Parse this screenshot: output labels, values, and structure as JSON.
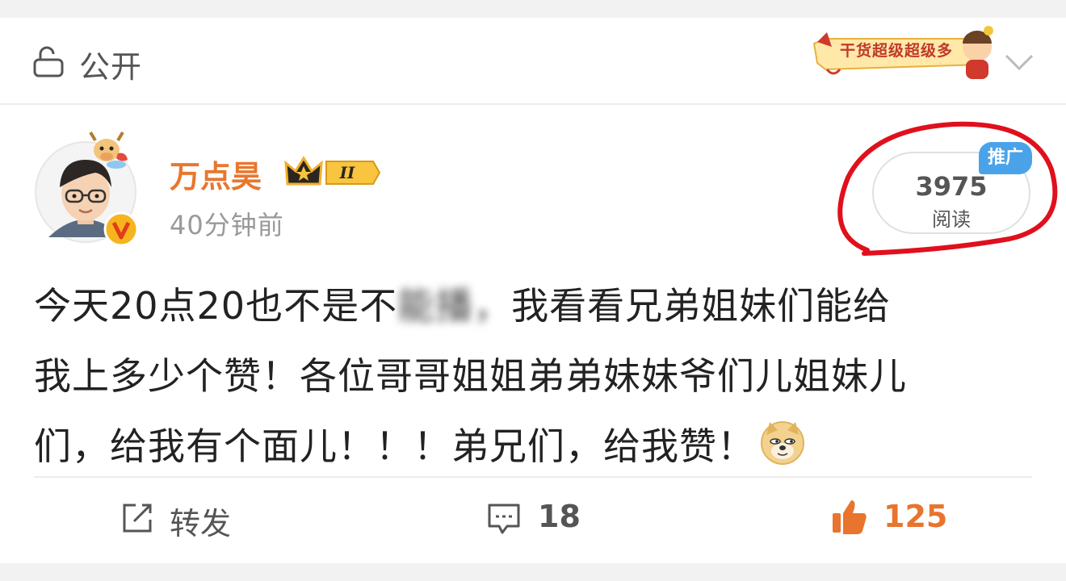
{
  "visibility": {
    "label": "公开"
  },
  "banner": {
    "text": "干货超级超级多"
  },
  "post": {
    "author": "万点昊",
    "vip_level": "II",
    "time": "40分钟前",
    "reads": {
      "count": "3975",
      "label": "阅读",
      "tag": "推广"
    },
    "text_line1_a": "今天20点20也不是不",
    "text_line1_blur": "能播，",
    "text_line1_b": "我看看兄弟姐妹们能给",
    "text_line2": "我上多少个赞！各位哥哥姐姐弟弟妹妹爷们儿姐妹儿",
    "text_line3": "们，给我有个面儿！！！弟兄们，给我赞！"
  },
  "actions": {
    "repost_label": "转发",
    "comment_count": "18",
    "like_count": "125"
  },
  "colors": {
    "author": "#e8772e",
    "like": "#e8742e",
    "promo_tag": "#4aa3e8",
    "annotation_circle": "#e0101c"
  }
}
